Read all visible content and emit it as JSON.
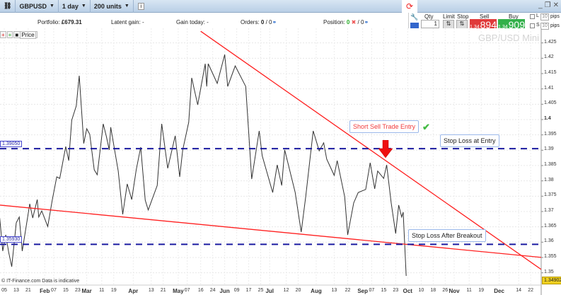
{
  "toolbar": {
    "symbol": "GBPUSD",
    "interval": "1 day",
    "units": "200 units",
    "info_icon": "info-icon"
  },
  "info": {
    "portfolio_label": "Portfolio:",
    "portfolio_value": "£679.31",
    "latent_label": "Latent gain:",
    "latent_value": "-",
    "gain_today_label": "Gain today:",
    "gain_today_value": "-",
    "orders_label": "Orders:",
    "orders_value": "0",
    "orders_sep": "/ 0",
    "position_label": "Position:",
    "position_value": "0",
    "position_sep": "/ 0"
  },
  "trade": {
    "qty_label": "Qty",
    "qty_value": "1",
    "limit_label": "Limit",
    "stop_label": "Stop",
    "sell_label": "Sell",
    "sell_prefix": "1.34",
    "sell_pips": "894",
    "buy_label": "Buy",
    "buy_prefix": "1.34",
    "buy_pips": "909",
    "l_label": "L",
    "s_label": "S",
    "l_pips": "10",
    "s_pips": "10",
    "pips_label": "pips",
    "sell_color": "#e03a3a",
    "buy_color": "#33b04a"
  },
  "legend": {
    "series": "Price"
  },
  "watermark": "GBP/USD Mini",
  "credit": "© IT-Finance.com  Data is indicative",
  "last_price": "1.34902",
  "annotations": {
    "entry": "Short Sell Trade Entry",
    "stop_entry": "Stop Loss at Entry",
    "stop_breakout": "Stop Loss After Breakout"
  },
  "chart_data": {
    "type": "line",
    "ylim": [
      1.345,
      1.4275
    ],
    "y_ticks": [
      "1.425",
      "1.42",
      "1.415",
      "1.41",
      "1.405",
      "1.4",
      "1.395",
      "1.39",
      "1.385",
      "1.38",
      "1.375",
      "1.37",
      "1.365",
      "1.36",
      "1.355",
      "1.35"
    ],
    "x_ticks": [
      {
        "label": "05",
        "date": "Jan 05"
      },
      {
        "label": "13",
        "date": "Jan 13"
      },
      {
        "label": "21",
        "date": "Jan 21"
      },
      {
        "label": "Feb",
        "date": "Feb 01",
        "month": true
      },
      {
        "label": "07",
        "date": "Feb 07"
      },
      {
        "label": "15",
        "date": "Feb 15"
      },
      {
        "label": "23",
        "date": "Feb 23"
      },
      {
        "label": "Mar",
        "date": "Mar 01",
        "month": true
      },
      {
        "label": "11",
        "date": "Mar 11"
      },
      {
        "label": "19",
        "date": "Mar 19"
      },
      {
        "label": "Apr",
        "date": "Apr 01",
        "month": true
      },
      {
        "label": "13",
        "date": "Apr 13"
      },
      {
        "label": "21",
        "date": "Apr 21"
      },
      {
        "label": "May",
        "date": "May 01",
        "month": true
      },
      {
        "label": "07",
        "date": "May 07"
      },
      {
        "label": "16",
        "date": "May 16"
      },
      {
        "label": "24",
        "date": "May 24"
      },
      {
        "label": "Jun",
        "date": "Jun 01",
        "month": true
      },
      {
        "label": "09",
        "date": "Jun 09"
      },
      {
        "label": "17",
        "date": "Jun 17"
      },
      {
        "label": "25",
        "date": "Jun 25"
      },
      {
        "label": "Jul",
        "date": "Jul 01",
        "month": true
      },
      {
        "label": "12",
        "date": "Jul 12"
      },
      {
        "label": "20",
        "date": "Jul 20"
      },
      {
        "label": "Aug",
        "date": "Aug 01",
        "month": true
      },
      {
        "label": "13",
        "date": "Aug 13"
      },
      {
        "label": "22",
        "date": "Aug 22"
      },
      {
        "label": "Sep",
        "date": "Sep 01",
        "month": true
      },
      {
        "label": "07",
        "date": "Sep 07"
      },
      {
        "label": "15",
        "date": "Sep 15"
      },
      {
        "label": "23",
        "date": "Sep 23"
      },
      {
        "label": "Oct",
        "date": "Oct 01",
        "month": true
      },
      {
        "label": "10",
        "date": "Oct 10"
      },
      {
        "label": "18",
        "date": "Oct 18"
      },
      {
        "label": "26",
        "date": "Oct 26"
      },
      {
        "label": "Nov",
        "date": "Nov 01",
        "month": true
      },
      {
        "label": "11",
        "date": "Nov 11"
      },
      {
        "label": "19",
        "date": "Nov 19"
      },
      {
        "label": "Dec",
        "date": "Dec 01",
        "month": true
      },
      {
        "label": "14",
        "date": "Dec 14"
      },
      {
        "label": "22",
        "date": "Dec 22"
      }
    ],
    "grid": true,
    "series": [
      {
        "name": "Price",
        "color": "#333333",
        "points": [
          [
            "Jan 02",
            1.3679
          ],
          [
            "Jan 04",
            1.3571
          ],
          [
            "Jan 06",
            1.3624
          ],
          [
            "Jan 08",
            1.3566
          ],
          [
            "Jan 10",
            1.352
          ],
          [
            "Jan 13",
            1.3663
          ],
          [
            "Jan 15",
            1.3682
          ],
          [
            "Jan 17",
            1.3571
          ],
          [
            "Jan 22",
            1.3725
          ],
          [
            "Jan 24",
            1.3679
          ],
          [
            "Jan 27",
            1.3739
          ],
          [
            "Jan 28",
            1.3682
          ],
          [
            "Jan 30",
            1.3702
          ],
          [
            "Feb 03",
            1.3651
          ],
          [
            "Feb 06",
            1.3737
          ],
          [
            "Feb 09",
            1.3813
          ],
          [
            "Feb 11",
            1.3808
          ],
          [
            "Feb 15",
            1.3912
          ],
          [
            "Feb 17",
            1.3866
          ],
          [
            "Feb 19",
            1.3998
          ],
          [
            "Feb 22",
            1.4044
          ],
          [
            "Feb 24",
            1.4143
          ],
          [
            "Feb 26",
            1.3998
          ],
          [
            "Feb 27",
            1.3922
          ],
          [
            "Mar 01",
            1.397
          ],
          [
            "Mar 03",
            1.3952
          ],
          [
            "Mar 06",
            1.3836
          ],
          [
            "Mar 08",
            1.382
          ],
          [
            "Mar 12",
            1.3986
          ],
          [
            "Mar 14",
            1.3947
          ],
          [
            "Mar 16",
            1.3901
          ],
          [
            "Mar 17",
            1.3975
          ],
          [
            "Mar 22",
            1.3832
          ],
          [
            "Mar 25",
            1.3691
          ],
          [
            "Mar 28",
            1.379
          ],
          [
            "Mar 31",
            1.3739
          ],
          [
            "Apr 03",
            1.3836
          ],
          [
            "Apr 06",
            1.391
          ],
          [
            "Apr 09",
            1.3737
          ],
          [
            "Apr 11",
            1.3705
          ],
          [
            "Apr 17",
            1.3785
          ],
          [
            "Apr 20",
            1.3986
          ],
          [
            "Apr 24",
            1.3841
          ],
          [
            "Apr 29",
            1.3947
          ],
          [
            "May 02",
            1.3813
          ],
          [
            "May 04",
            1.3901
          ],
          [
            "May 08",
            1.3991
          ],
          [
            "May 10",
            1.4136
          ],
          [
            "May 14",
            1.4048
          ],
          [
            "May 19",
            1.4182
          ],
          [
            "May 20",
            1.4108
          ],
          [
            "May 21",
            1.4182
          ],
          [
            "May 27",
            1.4118
          ],
          [
            "Jun 01",
            1.4212
          ],
          [
            "Jun 03",
            1.4108
          ],
          [
            "Jun 08",
            1.4175
          ],
          [
            "Jun 15",
            1.4108
          ],
          [
            "Jun 19",
            1.3806
          ],
          [
            "Jun 24",
            1.3963
          ],
          [
            "Jun 26",
            1.3882
          ],
          [
            "Jul 03",
            1.3762
          ],
          [
            "Jul 06",
            1.3852
          ],
          [
            "Jul 09",
            1.3785
          ],
          [
            "Jul 11",
            1.3901
          ],
          [
            "Jul 18",
            1.3762
          ],
          [
            "Jul 22",
            1.3633
          ],
          [
            "Jul 25",
            1.3748
          ],
          [
            "Jul 30",
            1.3963
          ],
          [
            "Aug 03",
            1.3898
          ],
          [
            "Aug 06",
            1.3924
          ],
          [
            "Aug 08",
            1.3871
          ],
          [
            "Aug 13",
            1.3818
          ],
          [
            "Aug 15",
            1.3866
          ],
          [
            "Aug 20",
            1.3748
          ],
          [
            "Aug 22",
            1.3624
          ],
          [
            "Aug 26",
            1.3728
          ],
          [
            "Aug 29",
            1.3762
          ],
          [
            "Sep 03",
            1.3772
          ],
          [
            "Sep 06",
            1.3859
          ],
          [
            "Sep 09",
            1.3774
          ],
          [
            "Sep 11",
            1.3832
          ],
          [
            "Sep 15",
            1.3808
          ],
          [
            "Sep 17",
            1.3852
          ],
          [
            "Sep 20",
            1.3728
          ],
          [
            "Sep 23",
            1.3628
          ],
          [
            "Sep 25",
            1.3721
          ],
          [
            "Sep 27",
            1.3682
          ],
          [
            "Sep 28",
            1.3698
          ],
          [
            "Sep 30",
            1.349
          ]
        ]
      }
    ],
    "trendlines": [
      {
        "from": [
          "May 16",
          1.4288
        ],
        "to": [
          "Dec 27",
          1.3518
        ],
        "color": "#ff2020"
      },
      {
        "from": [
          "Jan 02",
          1.3721
        ],
        "to": [
          "Dec 30",
          1.355
        ],
        "color": "#ff2020"
      }
    ],
    "hlines": [
      {
        "value": 1.3905,
        "label": "1.39050",
        "color": "#1a1aa0"
      },
      {
        "value": 1.3593,
        "label": "1.35930",
        "color": "#1a1aa0"
      }
    ]
  }
}
